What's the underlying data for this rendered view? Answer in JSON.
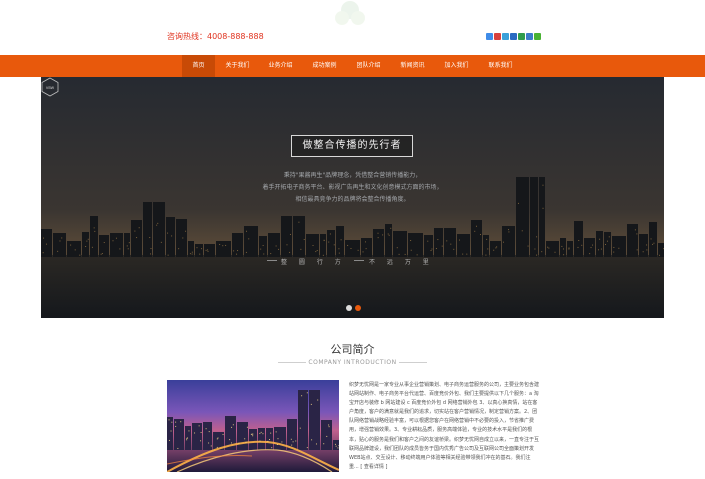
{
  "header": {
    "hotline": "咨询热线：4008-888-888"
  },
  "share_icons": [
    {
      "name": "qzone-icon",
      "color": "#3f8ce8"
    },
    {
      "name": "sina-weibo-icon",
      "color": "#d8403d"
    },
    {
      "name": "tencent-weibo-icon",
      "color": "#3ba0d9"
    },
    {
      "name": "renren-icon",
      "color": "#2a6ac1"
    },
    {
      "name": "douban-icon",
      "color": "#2f9c4c"
    },
    {
      "name": "people-icon",
      "color": "#3c7cc9"
    },
    {
      "name": "wechat-icon",
      "color": "#49b233"
    }
  ],
  "nav": {
    "items": [
      {
        "label": "首页",
        "active": true
      },
      {
        "label": "关于我们",
        "active": false
      },
      {
        "label": "业务介绍",
        "active": false
      },
      {
        "label": "成功案例",
        "active": false
      },
      {
        "label": "团队介绍",
        "active": false
      },
      {
        "label": "新闻资讯",
        "active": false
      },
      {
        "label": "加入我们",
        "active": false
      },
      {
        "label": "联系我们",
        "active": false
      }
    ]
  },
  "banner": {
    "slogan": "做整合传播的先行者",
    "lines": [
      "秉持\"果酱再生\"品牌理念，凭借整合营销传播能力，",
      "着手开拓电子商务平台、影视广告再生和文化创意模式方面的市场，",
      "相信最具竞争力的品牌将会整合传播角度。"
    ],
    "badge": "VBW",
    "motto_left": "整 圆 行 方",
    "motto_right": "不 远 万 里",
    "slides": 2,
    "active_slide": 2
  },
  "intro": {
    "title": "公司简介",
    "subtitle": "COMPANY INTRODUCTION",
    "text": "织梦无忧网是一家专业从事企业营销策划、电子商务运营服务的公司，主要业务包含建站网站制作、电子商务平台代运营、百度竞价外包、我们主要提供以下几个服务：a 淘宝开店与装修 b 网站建设 c 百度竞价外包 d 网络营销外包 3、以真心换真情，站在客户角度，客户的满意就是我们的追求，切实站在客户营销情况，制定营销方案。2、团队网络营销战略经验丰富，可以根据您客户在网络营销中不必要的投入，节省推广费用，增强营销效果。3、专业耕耘品质，服务高端体验，专业的技术水平是我们的根本，贴心的服务是我们和客户之间的友谊桥梁。织梦无忧网自成立以来，一直专注于互联网品牌建设，我们团队的成员皆务于国内优秀广告公司及互联网公司全面策划开发WEB站点、交互设计、移动终端用户体验等相关经验带领我们冲在的基石。我们注重... [ 查看详情 ]"
  },
  "colors": {
    "accent": "#e8590c",
    "accent_dark": "#c84a06",
    "hotline": "#e0321e",
    "dot_inactive": "#dcdcdc",
    "dot_active": "#e8590c"
  }
}
